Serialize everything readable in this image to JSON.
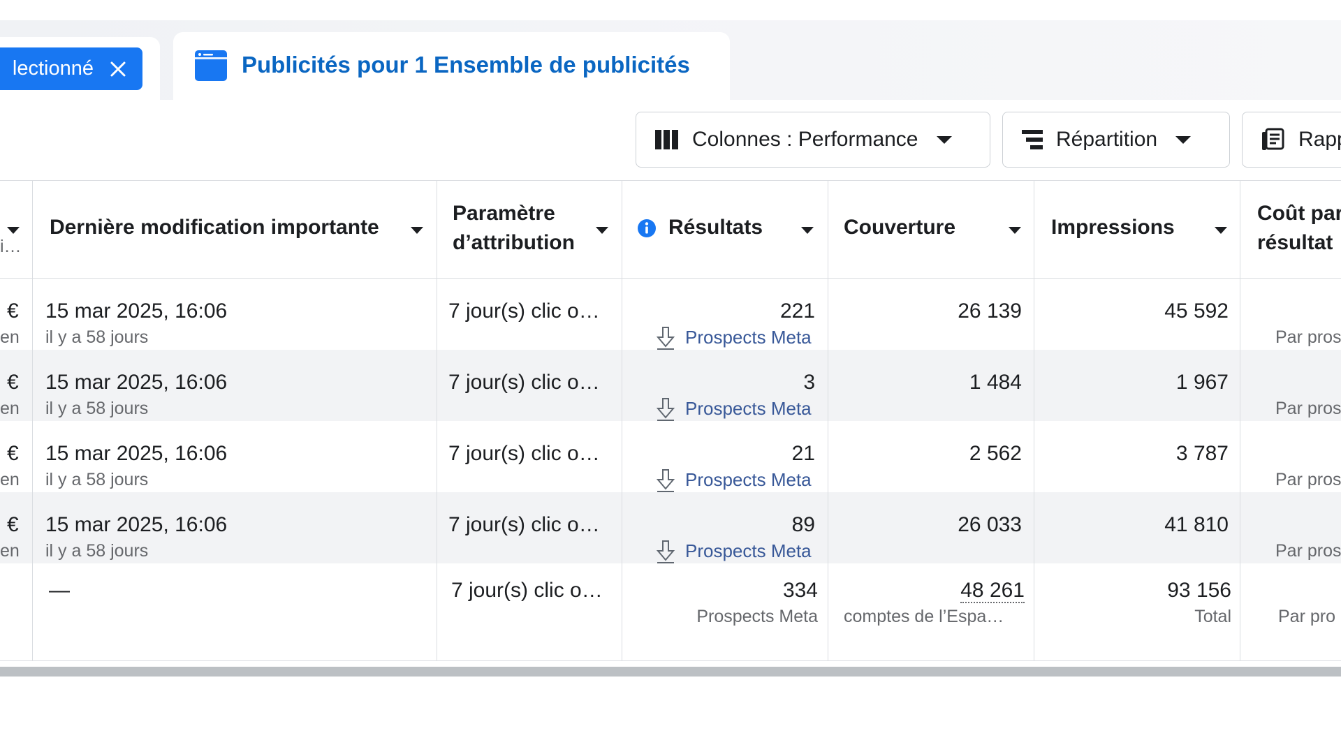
{
  "tabs": {
    "selected_label": "lectionné",
    "active_title": "Publicités pour 1 Ensemble de publicités"
  },
  "toolbar": {
    "columns_label": "Colonnes : Performance",
    "breakdown_label": "Répartition",
    "reports_label": "Rapp"
  },
  "table": {
    "headers": {
      "partial_left_sub": "i…",
      "last_change": "Dernière modification importante",
      "attribution_line1": "Paramètre",
      "attribution_line2": "d’attribution",
      "results": "Résultats",
      "reach": "Couverture",
      "impressions": "Impressions",
      "cost_line1": "Coût par",
      "cost_line2": "résultat"
    },
    "rows": [
      {
        "left_top": "€",
        "left_sub": "en",
        "date": "15 mar 2025, 16:06",
        "ago": "il y a 58 jours",
        "attribution": "7 jour(s) clic o…",
        "results": "221",
        "result_type": "Prospects Meta",
        "reach": "26 139",
        "impressions": "45 592",
        "cost_sub": "Par pros"
      },
      {
        "left_top": "€",
        "left_sub": "en",
        "date": "15 mar 2025, 16:06",
        "ago": "il y a 58 jours",
        "attribution": "7 jour(s) clic o…",
        "results": "3",
        "result_type": "Prospects Meta",
        "reach": "1 484",
        "impressions": "1 967",
        "cost_sub": "Par pros"
      },
      {
        "left_top": "€",
        "left_sub": "en",
        "date": "15 mar 2025, 16:06",
        "ago": "il y a 58 jours",
        "attribution": "7 jour(s) clic o…",
        "results": "21",
        "result_type": "Prospects Meta",
        "reach": "2 562",
        "impressions": "3 787",
        "cost_sub": "Par pros"
      },
      {
        "left_top": "€",
        "left_sub": "en",
        "date": "15 mar 2025, 16:06",
        "ago": "il y a 58 jours",
        "attribution": "7 jour(s) clic o…",
        "results": "89",
        "result_type": "Prospects Meta",
        "reach": "26 033",
        "impressions": "41 810",
        "cost_sub": "Par pros"
      }
    ],
    "total": {
      "date": "—",
      "attribution": "7 jour(s) clic o…",
      "results": "334",
      "result_type": "Prospects Meta",
      "reach": "48 261",
      "reach_sub": "comptes de l’Espa…",
      "impressions": "93 156",
      "impressions_sub": "Total",
      "cost_sub": "Par pro"
    }
  },
  "colors": {
    "accent": "#1877f2",
    "title_blue": "#0a66c2",
    "link": "#385898",
    "row_alt": "#f2f3f5"
  },
  "icons": [
    "close-icon",
    "ad-set-icon",
    "columns-icon",
    "breakdown-icon",
    "reports-icon",
    "info-icon",
    "download-icon",
    "caret-down-icon"
  ]
}
